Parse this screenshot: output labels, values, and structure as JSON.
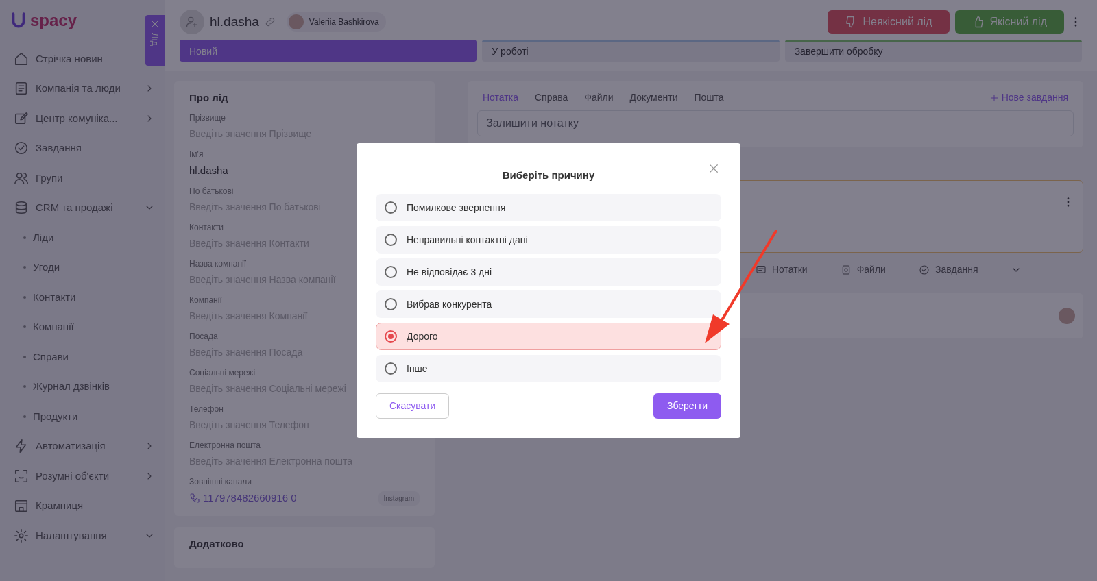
{
  "sidebar": {
    "logo_text": "spacy",
    "side_tab": {
      "label": "Лід"
    },
    "items": [
      {
        "label": "Стрічка новин",
        "kind": "leaf"
      },
      {
        "label": "Компанія та люди",
        "kind": "group",
        "expanded": false
      },
      {
        "label": "Центр комуніка...",
        "kind": "group",
        "expanded": false
      },
      {
        "label": "Завдання",
        "kind": "leaf"
      },
      {
        "label": "Групи",
        "kind": "leaf"
      },
      {
        "label": "CRM та продажі",
        "kind": "group",
        "expanded": true,
        "children": [
          {
            "label": "Ліди"
          },
          {
            "label": "Угоди"
          },
          {
            "label": "Контакти"
          },
          {
            "label": "Компанії"
          },
          {
            "label": "Справи"
          },
          {
            "label": "Журнал дзвінків"
          },
          {
            "label": "Продукти"
          }
        ]
      },
      {
        "label": "Автоматизація",
        "kind": "group",
        "expanded": false
      },
      {
        "label": "Розумні об'єкти",
        "kind": "group",
        "expanded": false
      },
      {
        "label": "Крамниця",
        "kind": "leaf"
      },
      {
        "label": "Налаштування",
        "kind": "group",
        "expanded": true
      }
    ]
  },
  "header": {
    "title": "hl.dasha",
    "owner": "Valeriia Bashkirova",
    "buttons": [
      {
        "label": "Неякісний лід",
        "kind": "bad"
      },
      {
        "label": "Якісний лід",
        "kind": "good"
      }
    ],
    "stages": [
      {
        "label": "Новий",
        "selected": true
      },
      {
        "label": "У роботі",
        "selected": false
      },
      {
        "label": "Завершити обробку",
        "selected": false
      }
    ]
  },
  "about": {
    "title": "Про лід",
    "fields": [
      {
        "label": "Прізвище",
        "placeholder": "Введіть значення Прізвище"
      },
      {
        "label": "Ім'я",
        "value": "hl.dasha"
      },
      {
        "label": "По батькові",
        "placeholder": "Введіть значення По батькові"
      },
      {
        "label": "Контакти",
        "placeholder": "Введіть значення Контакти"
      },
      {
        "label": "Назва компанії",
        "placeholder": "Введіть значення Назва компанії"
      },
      {
        "label": "Компанії",
        "placeholder": "Введіть значення Компанії"
      },
      {
        "label": "Посада",
        "placeholder": "Введіть значення Посада"
      },
      {
        "label": "Соціальні мережі",
        "placeholder": "Введіть значення Соціальні мережі"
      },
      {
        "label": "Телефон",
        "placeholder": "Введіть значення Телефон"
      },
      {
        "label": "Електронна пошта",
        "placeholder": "Введіть значення Електронна пошта"
      }
    ],
    "channels": {
      "label": "Зовнішні канали",
      "phone": "117978482660916 0",
      "badge": "Instagram"
    },
    "extra_title": "Додатково"
  },
  "activity": {
    "tabs": [
      {
        "label": "Нотатка",
        "selected": true
      },
      {
        "label": "Справа",
        "selected": false
      },
      {
        "label": "Файли",
        "selected": false
      },
      {
        "label": "Документи",
        "selected": false
      },
      {
        "label": "Пошта",
        "selected": false
      }
    ],
    "new_task": "Нове завдання",
    "note": {
      "placeholder": "Залишити нотатку"
    },
    "filters": [
      "Нотатки",
      "Файли",
      "Завдання"
    ]
  },
  "modal": {
    "title": "Виберіть причину",
    "options": [
      {
        "label": "Помилкове звернення",
        "selected": false
      },
      {
        "label": "Неправильні контактні дані",
        "selected": false
      },
      {
        "label": "Не відповідає 3 дні",
        "selected": false
      },
      {
        "label": "Вибрав конкурента",
        "selected": false
      },
      {
        "label": "Дорого",
        "selected": true
      },
      {
        "label": "Інше",
        "selected": false
      }
    ],
    "cancel": "Скасувати",
    "save": "Зберегти"
  }
}
